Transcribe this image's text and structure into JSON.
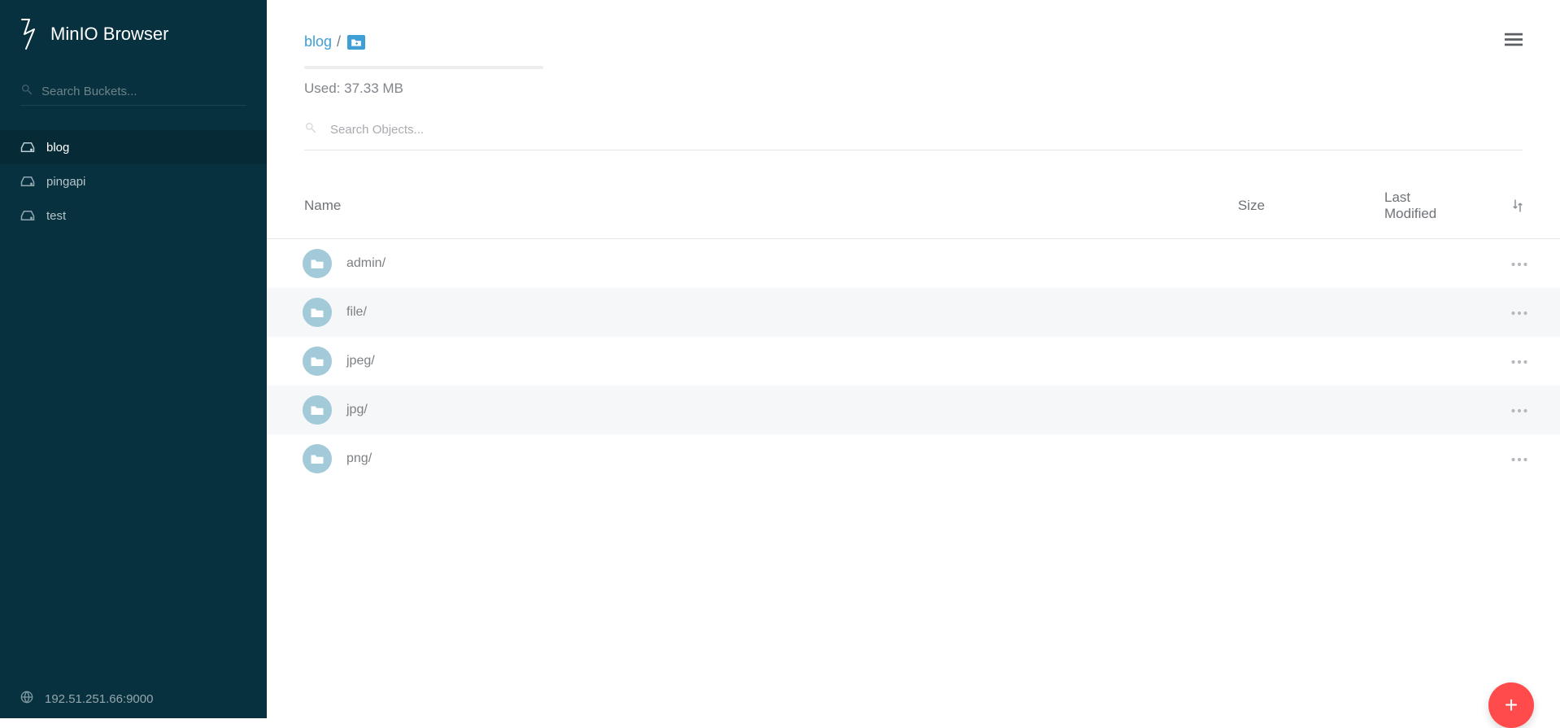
{
  "app": {
    "title": "MinIO Browser"
  },
  "sidebar": {
    "search_placeholder": "Search Buckets...",
    "buckets": [
      {
        "name": "blog",
        "active": true
      },
      {
        "name": "pingapi",
        "active": false
      },
      {
        "name": "test",
        "active": false
      }
    ],
    "footer_host": "192.51.251.66:9000"
  },
  "breadcrumb": {
    "root": "blog",
    "sep": "/"
  },
  "usage": {
    "text": "Used: 37.33 MB"
  },
  "object_search": {
    "placeholder": "Search Objects..."
  },
  "table": {
    "headers": {
      "name": "Name",
      "size": "Size",
      "modified": "Last Modified"
    },
    "rows": [
      {
        "name": "admin/",
        "size": "",
        "modified": ""
      },
      {
        "name": "file/",
        "size": "",
        "modified": ""
      },
      {
        "name": "jpeg/",
        "size": "",
        "modified": ""
      },
      {
        "name": "jpg/",
        "size": "",
        "modified": ""
      },
      {
        "name": "png/",
        "size": "",
        "modified": ""
      }
    ]
  }
}
